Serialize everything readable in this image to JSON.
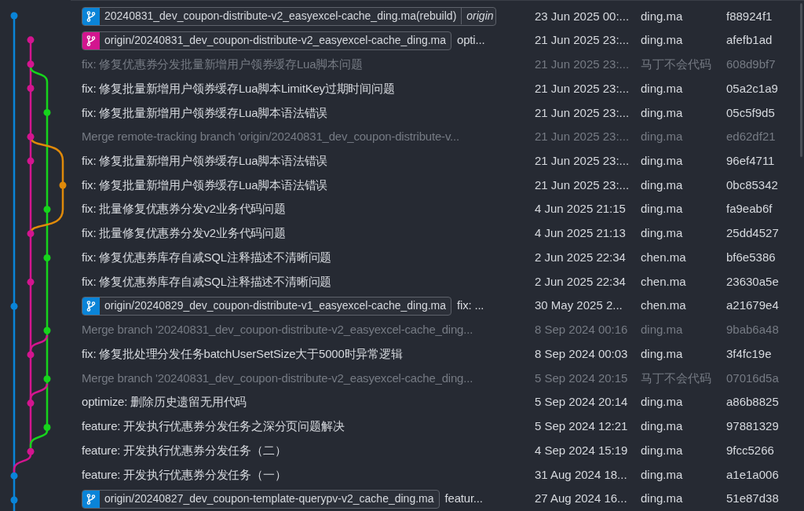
{
  "rows": [
    {
      "ref": {
        "label": "20240831_dev_coupon-distribute-v2_easyexcel-cache_ding.ma(rebuild)",
        "color": "#0a84d8",
        "extra": "origin"
      },
      "date": "23 Jun 2025 00:...",
      "author": "ding.ma",
      "hash": "f88924f1",
      "dimmed": false
    },
    {
      "ref": {
        "label": "origin/20240831_dev_coupon-distribute-v2_easyexcel-cache_ding.ma",
        "color": "#d3158f"
      },
      "message": "opti...",
      "date": "21 Jun 2025 23:...",
      "author": "ding.ma",
      "hash": "afefb1ad",
      "dimmed": false
    },
    {
      "message": "fix: 修复优惠券分发批量新增用户领券缓存Lua脚本问题",
      "date": "21 Jun 2025 23:...",
      "author": "马丁不会代码",
      "hash": "608d9bf7",
      "dimmed": true
    },
    {
      "message": "fix: 修复批量新增用户领券缓存Lua脚本LimitKey过期时间问题",
      "date": "21 Jun 2025 23:...",
      "author": "ding.ma",
      "hash": "05a2c1a9",
      "dimmed": false
    },
    {
      "message": "fix: 修复批量新增用户领券缓存Lua脚本语法错误",
      "date": "21 Jun 2025 23:...",
      "author": "ding.ma",
      "hash": "05c5f9d5",
      "dimmed": false
    },
    {
      "message": "Merge remote-tracking branch 'origin/20240831_dev_coupon-distribute-v...",
      "date": "21 Jun 2025 23:...",
      "author": "ding.ma",
      "hash": "ed62df21",
      "dimmed": true
    },
    {
      "message": "fix: 修复批量新增用户领券缓存Lua脚本语法错误",
      "date": "21 Jun 2025 23:...",
      "author": "ding.ma",
      "hash": "96ef4711",
      "dimmed": false
    },
    {
      "message": "fix: 修复批量新增用户领券缓存Lua脚本语法错误",
      "date": "21 Jun 2025 23:...",
      "author": "ding.ma",
      "hash": "0bc85342",
      "dimmed": false
    },
    {
      "message": "fix: 批量修复优惠券分发v2业务代码问题",
      "date": "4 Jun 2025 21:15",
      "author": "ding.ma",
      "hash": "fa9eab6f",
      "dimmed": false
    },
    {
      "message": "fix: 批量修复优惠券分发v2业务代码问题",
      "date": "4 Jun 2025 21:13",
      "author": "ding.ma",
      "hash": "25dd4527",
      "dimmed": false
    },
    {
      "message": "fix: 修复优惠券库存自减SQL注释描述不清晰问题",
      "date": "2 Jun 2025 22:34",
      "author": "chen.ma",
      "hash": "bf6e5386",
      "dimmed": false
    },
    {
      "message": "fix: 修复优惠券库存自减SQL注释描述不清晰问题",
      "date": "2 Jun 2025 22:34",
      "author": "chen.ma",
      "hash": "23630a5e",
      "dimmed": false
    },
    {
      "ref": {
        "label": "origin/20240829_dev_coupon-distribute-v1_easyexcel-cache_ding.ma",
        "color": "#0a84d8"
      },
      "message": "fix: ...",
      "date": "30 May 2025 2...",
      "author": "chen.ma",
      "hash": "a21679e4",
      "dimmed": false
    },
    {
      "message": "Merge branch '20240831_dev_coupon-distribute-v2_easyexcel-cache_ding...",
      "date": "8 Sep 2024 00:16",
      "author": "ding.ma",
      "hash": "9bab6a48",
      "dimmed": true
    },
    {
      "message": "fix: 修复批处理分发任务batchUserSetSize大于5000时异常逻辑",
      "date": "8 Sep 2024 00:03",
      "author": "ding.ma",
      "hash": "3f4fc19e",
      "dimmed": false
    },
    {
      "message": "Merge branch '20240831_dev_coupon-distribute-v2_easyexcel-cache_ding...",
      "date": "5 Sep 2024 20:15",
      "author": "马丁不会代码",
      "hash": "07016d5a",
      "dimmed": true
    },
    {
      "message": "optimize: 删除历史遗留无用代码",
      "date": "5 Sep 2024 20:14",
      "author": "ding.ma",
      "hash": "a86b8825",
      "dimmed": false
    },
    {
      "message": "feature: 开发执行优惠券分发任务之深分页问题解决",
      "date": "5 Sep 2024 12:21",
      "author": "ding.ma",
      "hash": "97881329",
      "dimmed": false
    },
    {
      "message": "feature: 开发执行优惠券分发任务（二）",
      "date": "4 Sep 2024 15:19",
      "author": "ding.ma",
      "hash": "9fcc5266",
      "dimmed": false
    },
    {
      "message": "feature: 开发执行优惠券分发任务（一）",
      "date": "31 Aug 2024 18...",
      "author": "ding.ma",
      "hash": "a1e1a006",
      "dimmed": false
    },
    {
      "ref": {
        "label": "origin/20240827_dev_coupon-template-querypv-v2_cache_ding.ma",
        "color": "#0a84d8"
      },
      "message": "featur...",
      "date": "27 Aug 2024 16...",
      "author": "ding.ma",
      "hash": "51e87d38",
      "dimmed": false
    }
  ]
}
